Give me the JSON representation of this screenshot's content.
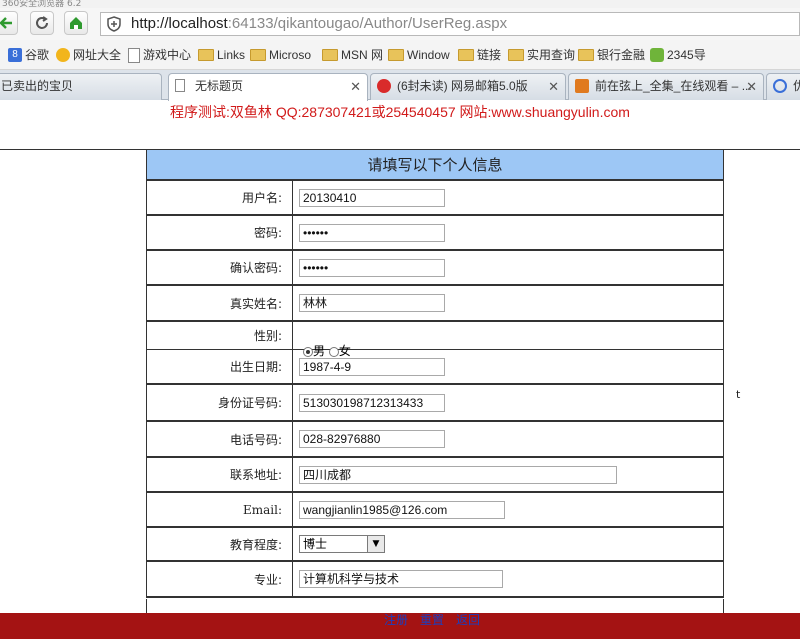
{
  "titlebar": {
    "text": "360安全浏览器 6.2"
  },
  "browser": {
    "url_host": "http://localhost",
    "url_rest": ":64133/qikantougao/Author/UserReg.aspx"
  },
  "bookmarks": [
    "谷歌",
    "网址大全",
    "游戏中心",
    "Links",
    "Microso",
    "MSN 网",
    "Window",
    "链接",
    "实用查询",
    "银行金融",
    "2345导"
  ],
  "tabs": [
    {
      "label": "已卖出的宝贝"
    },
    {
      "label": "无标题页"
    },
    {
      "label": "(6封未读) 网易邮箱5.0版"
    },
    {
      "label": "前在弦上_全集_在线观看 – ..."
    },
    {
      "label": "优"
    }
  ],
  "banner": {
    "text": "程序测试:双鱼林 QQ:287307421或254540457 网站:www.shuangyulin.com"
  },
  "form": {
    "title": "请填写以下个人信息",
    "fields": {
      "username": {
        "label": "用户名:",
        "value": "20130410"
      },
      "password": {
        "label": "密码:",
        "value": "••••••"
      },
      "confirm": {
        "label": "确认密码:",
        "value": "••••••"
      },
      "realname": {
        "label": "真实姓名:",
        "value": "林林"
      },
      "gender": {
        "label": "性别:",
        "male": "男",
        "female": "女"
      },
      "birthday": {
        "label": "出生日期:",
        "value": "1987-4-9"
      },
      "idcard": {
        "label": "身份证号码:",
        "value": "513030198712313433"
      },
      "phone": {
        "label": "电话号码:",
        "value": "028-82976880"
      },
      "address": {
        "label": "联系地址:",
        "value": "四川成都"
      },
      "email": {
        "label": "Email:",
        "value": "wangjianlin1985@126.com"
      },
      "education": {
        "label": "教育程度:",
        "value": "博士"
      },
      "major": {
        "label": "专业:",
        "value": "计算机科学与技术"
      }
    },
    "side_text": "t",
    "actions": {
      "register": "注册",
      "reset": "重置",
      "back": "返回"
    }
  }
}
